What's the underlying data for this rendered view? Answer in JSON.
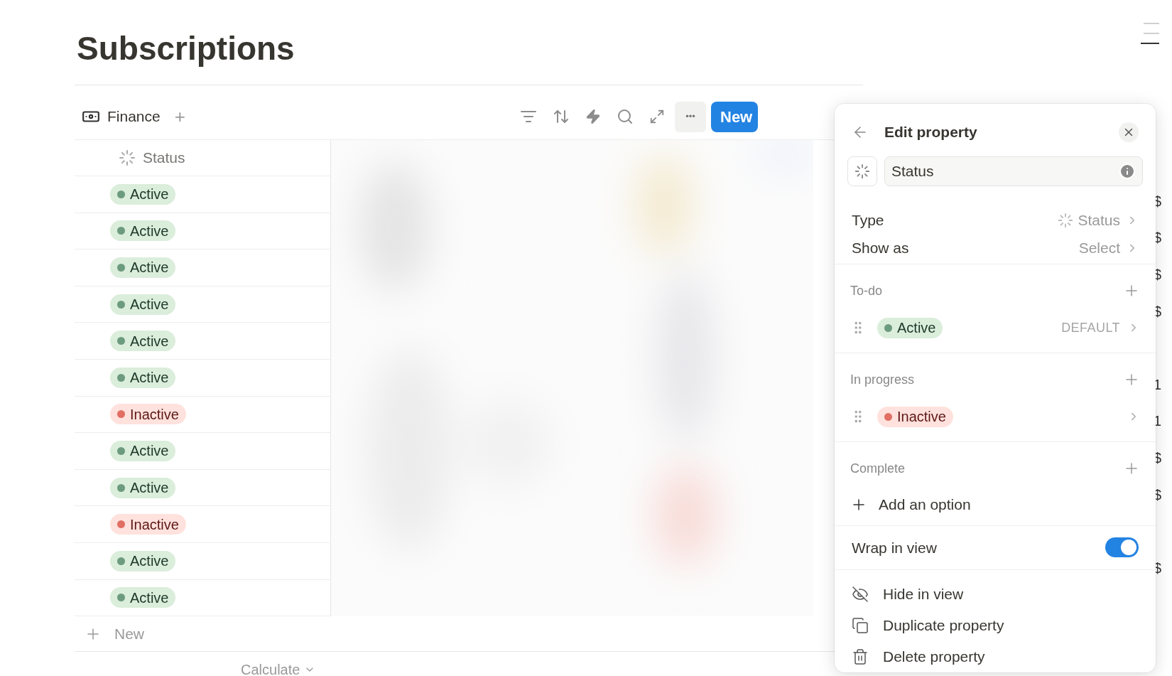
{
  "page": {
    "title": "Subscriptions"
  },
  "view_tab": {
    "label": "Finance",
    "add": "+"
  },
  "toolbar": {
    "more": "•••",
    "new_button": "New"
  },
  "table": {
    "status_header": "Status",
    "rows": [
      {
        "status": "Active",
        "kind": "active",
        "edge_value": "$"
      },
      {
        "status": "Active",
        "kind": "active",
        "edge_value": "$"
      },
      {
        "status": "Active",
        "kind": "active",
        "edge_value": "$"
      },
      {
        "status": "Active",
        "kind": "active",
        "edge_value": "$"
      },
      {
        "status": "Active",
        "kind": "active"
      },
      {
        "status": "Active",
        "kind": "active",
        "edge_value": "1"
      },
      {
        "status": "Inactive",
        "kind": "inactive",
        "edge_value": "1"
      },
      {
        "status": "Active",
        "kind": "active",
        "edge_value": "$"
      },
      {
        "status": "Active",
        "kind": "active",
        "edge_value": "$"
      },
      {
        "status": "Inactive",
        "kind": "inactive"
      },
      {
        "status": "Active",
        "kind": "active",
        "edge_value": "$"
      },
      {
        "status": "Active",
        "kind": "active"
      }
    ],
    "new_row": "New",
    "calculate": "Calculate"
  },
  "panel": {
    "title": "Edit property",
    "name_value": "Status",
    "type_label": "Type",
    "type_value": "Status",
    "show_as_label": "Show as",
    "show_as_value": "Select",
    "groups": [
      {
        "label": "To-do",
        "options": [
          {
            "name": "Active",
            "kind": "active",
            "note": "DEFAULT"
          }
        ]
      },
      {
        "label": "In progress",
        "options": [
          {
            "name": "Inactive",
            "kind": "inactive"
          }
        ]
      },
      {
        "label": "Complete"
      }
    ],
    "add_option": "Add an option",
    "wrap": {
      "label": "Wrap in view",
      "on": true
    },
    "actions": [
      {
        "label": "Hide in view",
        "kind": "hide"
      },
      {
        "label": "Duplicate property",
        "kind": "duplicate"
      },
      {
        "label": "Delete property",
        "kind": "delete"
      }
    ]
  }
}
